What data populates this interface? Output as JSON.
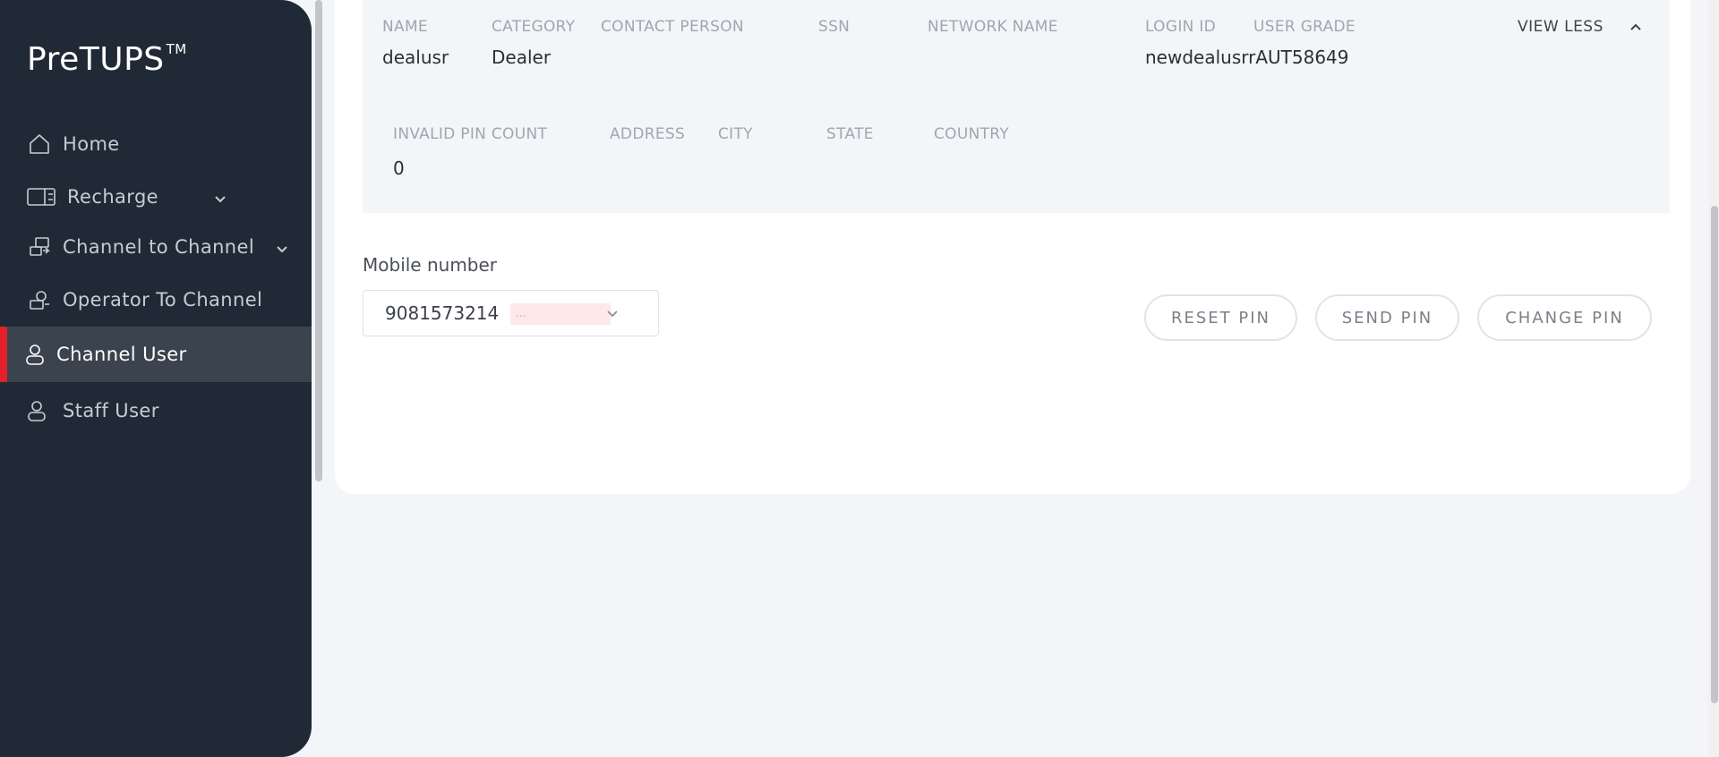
{
  "sidebar": {
    "brand": "PreTUPS",
    "brand_tm": "TM",
    "items": [
      {
        "label": "Home"
      },
      {
        "label": "Recharge"
      },
      {
        "label": "Channel to Channel"
      },
      {
        "label": "Operator To Channel"
      },
      {
        "label": "Channel User"
      },
      {
        "label": "Staff User"
      }
    ]
  },
  "details": {
    "row1": [
      {
        "header": "NAME",
        "value": "dealusr"
      },
      {
        "header": "CATEGORY",
        "value": "Dealer"
      },
      {
        "header": "CONTACT PERSON",
        "value": ""
      },
      {
        "header": "SSN",
        "value": ""
      },
      {
        "header": "NETWORK NAME",
        "value": ""
      },
      {
        "header": "LOGIN ID",
        "value": "newdealusrrAUT58649"
      },
      {
        "header": "USER GRADE",
        "value": ""
      }
    ],
    "row2": [
      {
        "header": "INVALID PIN COUNT",
        "value": "0"
      },
      {
        "header": "ADDRESS",
        "value": ""
      },
      {
        "header": "CITY",
        "value": ""
      },
      {
        "header": "STATE",
        "value": ""
      },
      {
        "header": "COUNTRY",
        "value": ""
      }
    ],
    "toggle_label": "VIEW LESS"
  },
  "mobile": {
    "label": "Mobile number",
    "selected": "9081573214",
    "masked": "..."
  },
  "actions": {
    "reset_pin": "RESET PIN",
    "send_pin": "SEND PIN",
    "change_pin": "CHANGE PIN"
  },
  "colors": {
    "sidebar_bg": "#202a36",
    "active_accent": "#e3202c"
  }
}
